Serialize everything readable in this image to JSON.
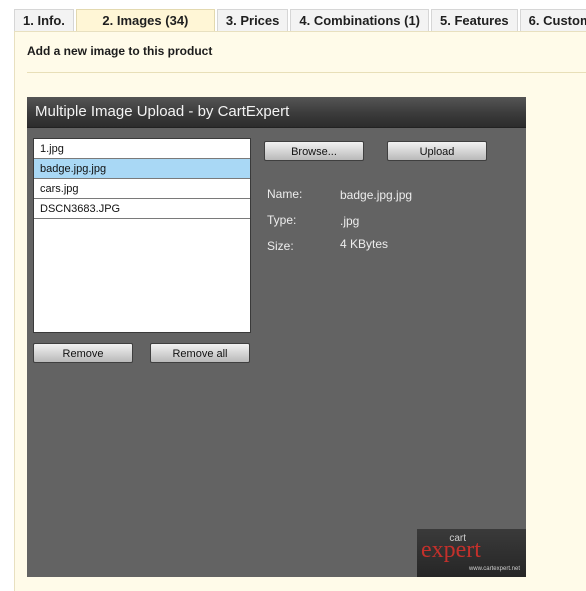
{
  "tabs": [
    {
      "label": "1. Info.",
      "active": false
    },
    {
      "label": "2. Images (34)",
      "active": true
    },
    {
      "label": "3. Prices",
      "active": false
    },
    {
      "label": "4. Combinations (1)",
      "active": false
    },
    {
      "label": "5. Features",
      "active": false
    },
    {
      "label": "6. Customiz",
      "active": false
    }
  ],
  "section": {
    "title": "Add a new image to this product"
  },
  "uploader": {
    "title": "Multiple Image Upload - by CartExpert",
    "files": [
      {
        "name": "1.jpg",
        "selected": false
      },
      {
        "name": "badge.jpg.jpg",
        "selected": true
      },
      {
        "name": "cars.jpg",
        "selected": false
      },
      {
        "name": "DSCN3683.JPG",
        "selected": false
      }
    ],
    "buttons": {
      "remove": "Remove",
      "remove_all": "Remove all",
      "browse": "Browse...",
      "upload": "Upload"
    },
    "details": {
      "name_label": "Name:",
      "name_value": "badge.jpg.jpg",
      "type_label": "Type:",
      "type_value": ".jpg",
      "size_label": "Size:",
      "size_value": "4 KBytes"
    },
    "logo": {
      "cart": "cart",
      "expert": "expert",
      "url": "www.cartexpert.net"
    }
  }
}
